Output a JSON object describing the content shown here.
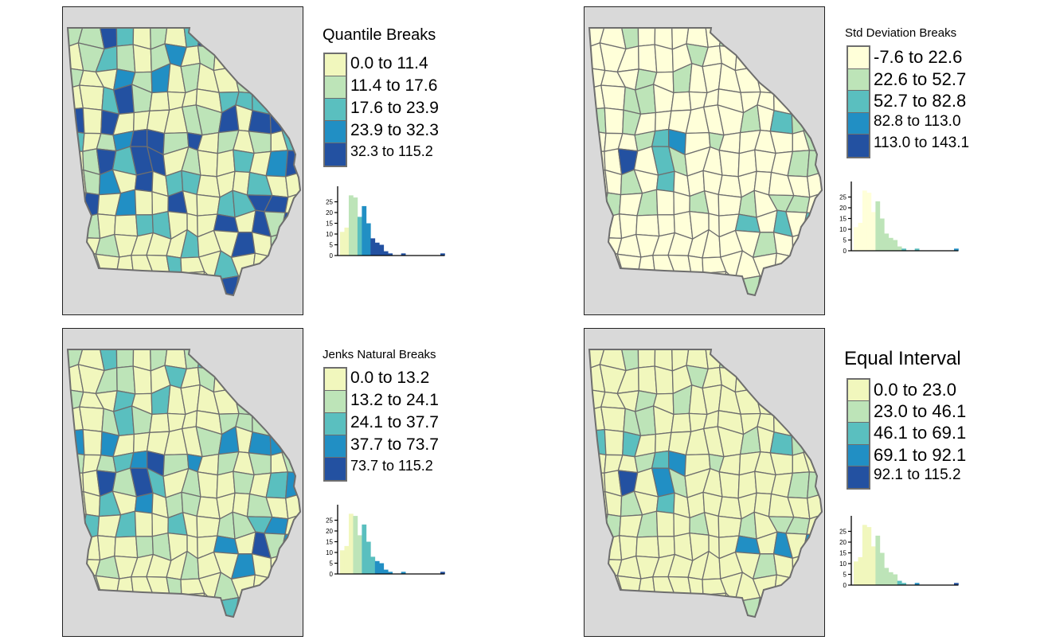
{
  "palette": [
    "#f1f7bd",
    "#bde4b8",
    "#5abfbf",
    "#218fc4",
    "#2351a1"
  ],
  "stddev_palette": [
    "#ffffd9",
    "#bde4b8",
    "#5abfbf",
    "#218fc4",
    "#2351a1"
  ],
  "map_background": "#d9d9d9",
  "county_border": "#6e6e6e",
  "chart_data": [
    {
      "type": "map-choropleth",
      "title": "Quantile Breaks",
      "region": "Georgia counties",
      "legend": [
        {
          "label": "0.0 to 11.4",
          "color": "#f1f7bd"
        },
        {
          "label": "11.4 to 17.6",
          "color": "#bde4b8"
        },
        {
          "label": "17.6 to 23.9",
          "color": "#5abfbf"
        },
        {
          "label": "23.9 to 32.3",
          "color": "#218fc4"
        },
        {
          "label": "32.3 to 115.2",
          "color": "#2351a1"
        }
      ],
      "breaks": [
        0.0,
        11.4,
        17.6,
        23.9,
        32.3,
        115.2
      ],
      "histogram": {
        "type": "bar",
        "x_range": [
          0,
          115.2
        ],
        "counts": [
          11,
          13,
          28,
          27,
          18,
          23,
          15,
          8,
          6,
          5,
          2,
          1,
          0,
          0,
          1,
          0,
          0,
          0,
          0,
          0,
          0,
          0,
          0,
          1
        ],
        "yticks": [
          0,
          5,
          10,
          15,
          20,
          25
        ],
        "ylim": [
          0,
          30
        ]
      }
    },
    {
      "type": "map-choropleth",
      "title": "Std Deviation Breaks",
      "region": "Georgia counties",
      "legend": [
        {
          "label": "-7.6 to 22.6",
          "color": "#ffffd9"
        },
        {
          "label": "22.6 to 52.7",
          "color": "#bde4b8"
        },
        {
          "label": "52.7 to 82.8",
          "color": "#5abfbf"
        },
        {
          "label": "82.8 to 113.0",
          "color": "#218fc4"
        },
        {
          "label": "113.0 to 143.1",
          "color": "#2351a1"
        }
      ],
      "breaks": [
        -7.6,
        22.6,
        52.7,
        82.8,
        113.0,
        143.1
      ],
      "histogram": {
        "type": "bar",
        "x_range": [
          0,
          115.2
        ],
        "counts": [
          11,
          13,
          28,
          27,
          18,
          23,
          15,
          8,
          6,
          5,
          2,
          1,
          0,
          0,
          1,
          0,
          0,
          0,
          0,
          0,
          0,
          0,
          0,
          1
        ],
        "yticks": [
          0,
          5,
          10,
          15,
          20,
          25
        ],
        "ylim": [
          0,
          30
        ]
      }
    },
    {
      "type": "map-choropleth",
      "title": "Jenks Natural Breaks",
      "region": "Georgia counties",
      "legend": [
        {
          "label": "0.0 to 13.2",
          "color": "#f1f7bd"
        },
        {
          "label": "13.2 to 24.1",
          "color": "#bde4b8"
        },
        {
          "label": "24.1 to 37.7",
          "color": "#5abfbf"
        },
        {
          "label": "37.7 to 73.7",
          "color": "#218fc4"
        },
        {
          "label": "73.7 to 115.2",
          "color": "#2351a1"
        }
      ],
      "breaks": [
        0.0,
        13.2,
        24.1,
        37.7,
        73.7,
        115.2
      ],
      "histogram": {
        "type": "bar",
        "x_range": [
          0,
          115.2
        ],
        "counts": [
          11,
          13,
          28,
          27,
          18,
          23,
          15,
          8,
          6,
          5,
          2,
          1,
          0,
          0,
          1,
          0,
          0,
          0,
          0,
          0,
          0,
          0,
          0,
          1
        ],
        "yticks": [
          0,
          5,
          10,
          15,
          20,
          25
        ],
        "ylim": [
          0,
          30
        ]
      }
    },
    {
      "type": "map-choropleth",
      "title": "Equal Interval",
      "region": "Georgia counties",
      "legend": [
        {
          "label": "0.0 to 23.0",
          "color": "#f1f7bd"
        },
        {
          "label": "23.0 to 46.1",
          "color": "#bde4b8"
        },
        {
          "label": "46.1 to 69.1",
          "color": "#5abfbf"
        },
        {
          "label": "69.1 to 92.1",
          "color": "#218fc4"
        },
        {
          "label": "92.1 to 115.2",
          "color": "#2351a1"
        }
      ],
      "breaks": [
        0.0,
        23.0,
        46.1,
        69.1,
        92.1,
        115.2
      ],
      "histogram": {
        "type": "bar",
        "x_range": [
          0,
          115.2
        ],
        "counts": [
          11,
          13,
          28,
          27,
          18,
          23,
          15,
          8,
          6,
          5,
          2,
          1,
          0,
          0,
          1,
          0,
          0,
          0,
          0,
          0,
          0,
          0,
          0,
          1
        ],
        "yticks": [
          0,
          5,
          10,
          15,
          20,
          25
        ],
        "ylim": [
          0,
          30
        ]
      }
    }
  ]
}
